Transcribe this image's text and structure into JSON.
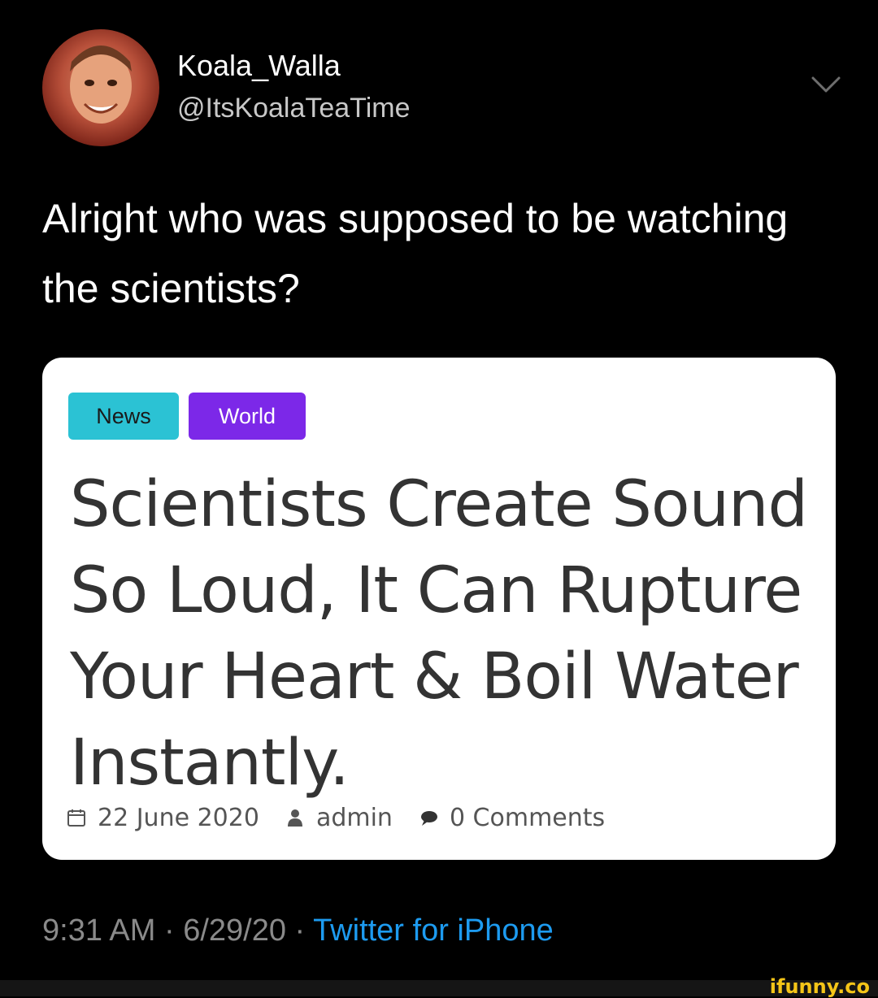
{
  "tweet": {
    "display_name": "Koala_Walla",
    "handle": "@ItsKoalaTeaTime",
    "text": "Alright who was supposed to be watching the scientists?",
    "timestamp": "9:31 AM · 6/29/20 · ",
    "source": "Twitter for iPhone"
  },
  "card": {
    "tags": [
      "News",
      "World"
    ],
    "headline": "Scientists Create Sound So Loud, It Can Rupture Your Heart & Boil Water Instantly.",
    "date": "22 June 2020",
    "author": "admin",
    "comments": "0 Comments"
  },
  "watermark": "ifunny.co",
  "colors": {
    "background": "#000000",
    "link_blue": "#1d9bf0",
    "tag_news": "#2bc2d4",
    "tag_world": "#7c28e8"
  },
  "icons": [
    "chevron-down-icon",
    "calendar-icon",
    "user-icon",
    "comment-icon"
  ]
}
